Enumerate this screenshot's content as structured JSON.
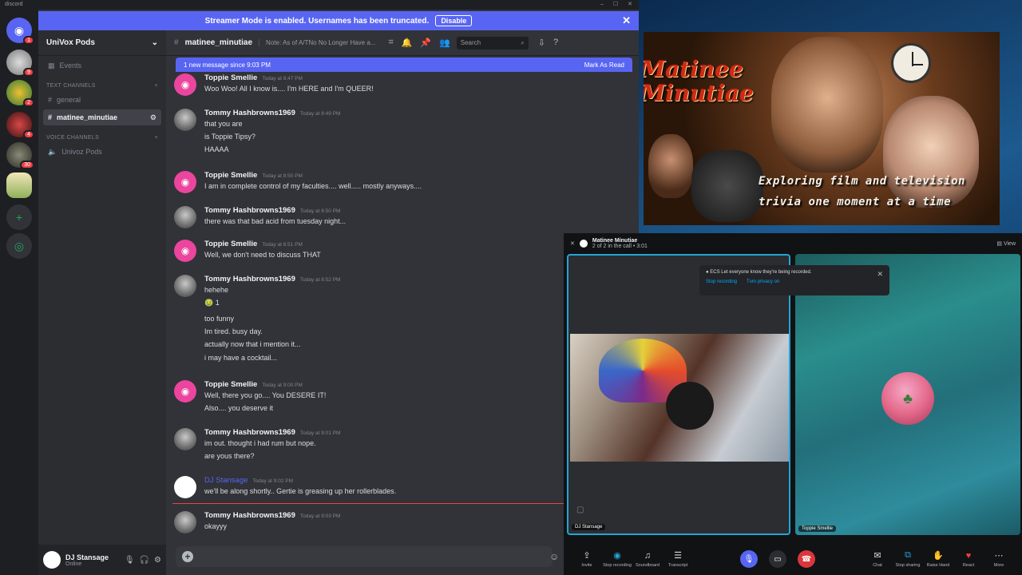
{
  "window": {
    "title": "discord"
  },
  "banner": {
    "text": "Streamer Mode is enabled. Usernames has been truncated.",
    "disable_label": "Disable",
    "close": "✕"
  },
  "rail": {
    "badges": [
      "1",
      "9",
      "2",
      "4",
      "30"
    ]
  },
  "server": {
    "name": "UniVox Pods",
    "events_label": "Events"
  },
  "categories": {
    "text": "TEXT CHANNELS",
    "voice": "VOICE CHANNELS"
  },
  "channels": {
    "general": "general",
    "active": "matinee_minutiae",
    "voice": "Univoz Pods"
  },
  "user": {
    "name": "DJ Stansage",
    "status": "Online"
  },
  "chat": {
    "channel": "matinee_minutiae",
    "topic": "Note: As of A/TNo No Longer Have a...",
    "search_placeholder": "Search",
    "new_messages": "1 new message since 9:03 PM",
    "mark_read": "Mark As Read",
    "input_placeholder": ""
  },
  "messages": [
    {
      "author": "Toppie Smellie",
      "ts": "Today at 8:47 PM",
      "lines": [
        "Woo Woo!  All I know is.... I'm HERE and I'm QUEER!"
      ]
    },
    {
      "author": "Tommy Hashbrowns1969",
      "ts": "Today at 8:49 PM",
      "lines": [
        "that you are",
        "is Toppie Tipsy?",
        "HAAAA"
      ]
    },
    {
      "author": "Toppie Smellie",
      "ts": "Today at 8:50 PM",
      "lines": [
        "I am in complete control of my faculties.... well..... mostly anyways...."
      ]
    },
    {
      "author": "Tommy Hashbrowns1969",
      "ts": "Today at 8:50 PM",
      "lines": [
        "there was that bad acid from tuesday night..."
      ]
    },
    {
      "author": "Toppie Smellie",
      "ts": "Today at 8:51 PM",
      "lines": [
        "Well, we don't need to discuss THAT"
      ]
    },
    {
      "author": "Tommy Hashbrowns1969",
      "ts": "Today at 8:52 PM",
      "lines": [
        "hehehe",
        "🤢 1",
        "too funny",
        "Im tired. busy day.",
        "actually now that i mention it...",
        "i may have a cocktail..."
      ]
    },
    {
      "author": "Toppie Smellie",
      "ts": "Today at 9:00 PM",
      "lines": [
        "Well, there you go.... You DESERE IT!",
        "Also.... you deserve it"
      ]
    },
    {
      "author": "Tommy Hashbrowns1969",
      "ts": "Today at 9:01 PM",
      "lines": [
        "im out. thought i had rum but nope.",
        "are yous there?"
      ]
    },
    {
      "author": "DJ Stansage",
      "ts": "Today at 9:02 PM",
      "lines": [
        "we'll be along shortly.. Gertie is greasing up her rollerblades."
      ]
    },
    {
      "author": "Tommy Hashbrowns1969",
      "ts": "Today at 9:03 PM",
      "lines": [
        "okayyy"
      ]
    }
  ],
  "video": {
    "title_line1": "Matinee",
    "title_line2": "Minutiae",
    "tagline_line1": "Exploring film and television",
    "tagline_line2": "trivia one moment at a time"
  },
  "call": {
    "channel": "Matinee Minutiae",
    "subtitle": "2 of 2 in the call • 3:01",
    "view_label": "View",
    "toast_text": "ECS Let everyone know they're being recorded.",
    "toast_link1": "Stop recording",
    "toast_link2": "Turn privacy on",
    "left_label": "DJ Stansage",
    "right_label": "Toppie Smellie",
    "toolbar": [
      "Invite",
      "Stop recording",
      "Soundboard",
      "Transcript",
      "",
      "",
      "",
      "Chat",
      "Stop sharing",
      "Raise Hand",
      "React",
      "More"
    ]
  }
}
